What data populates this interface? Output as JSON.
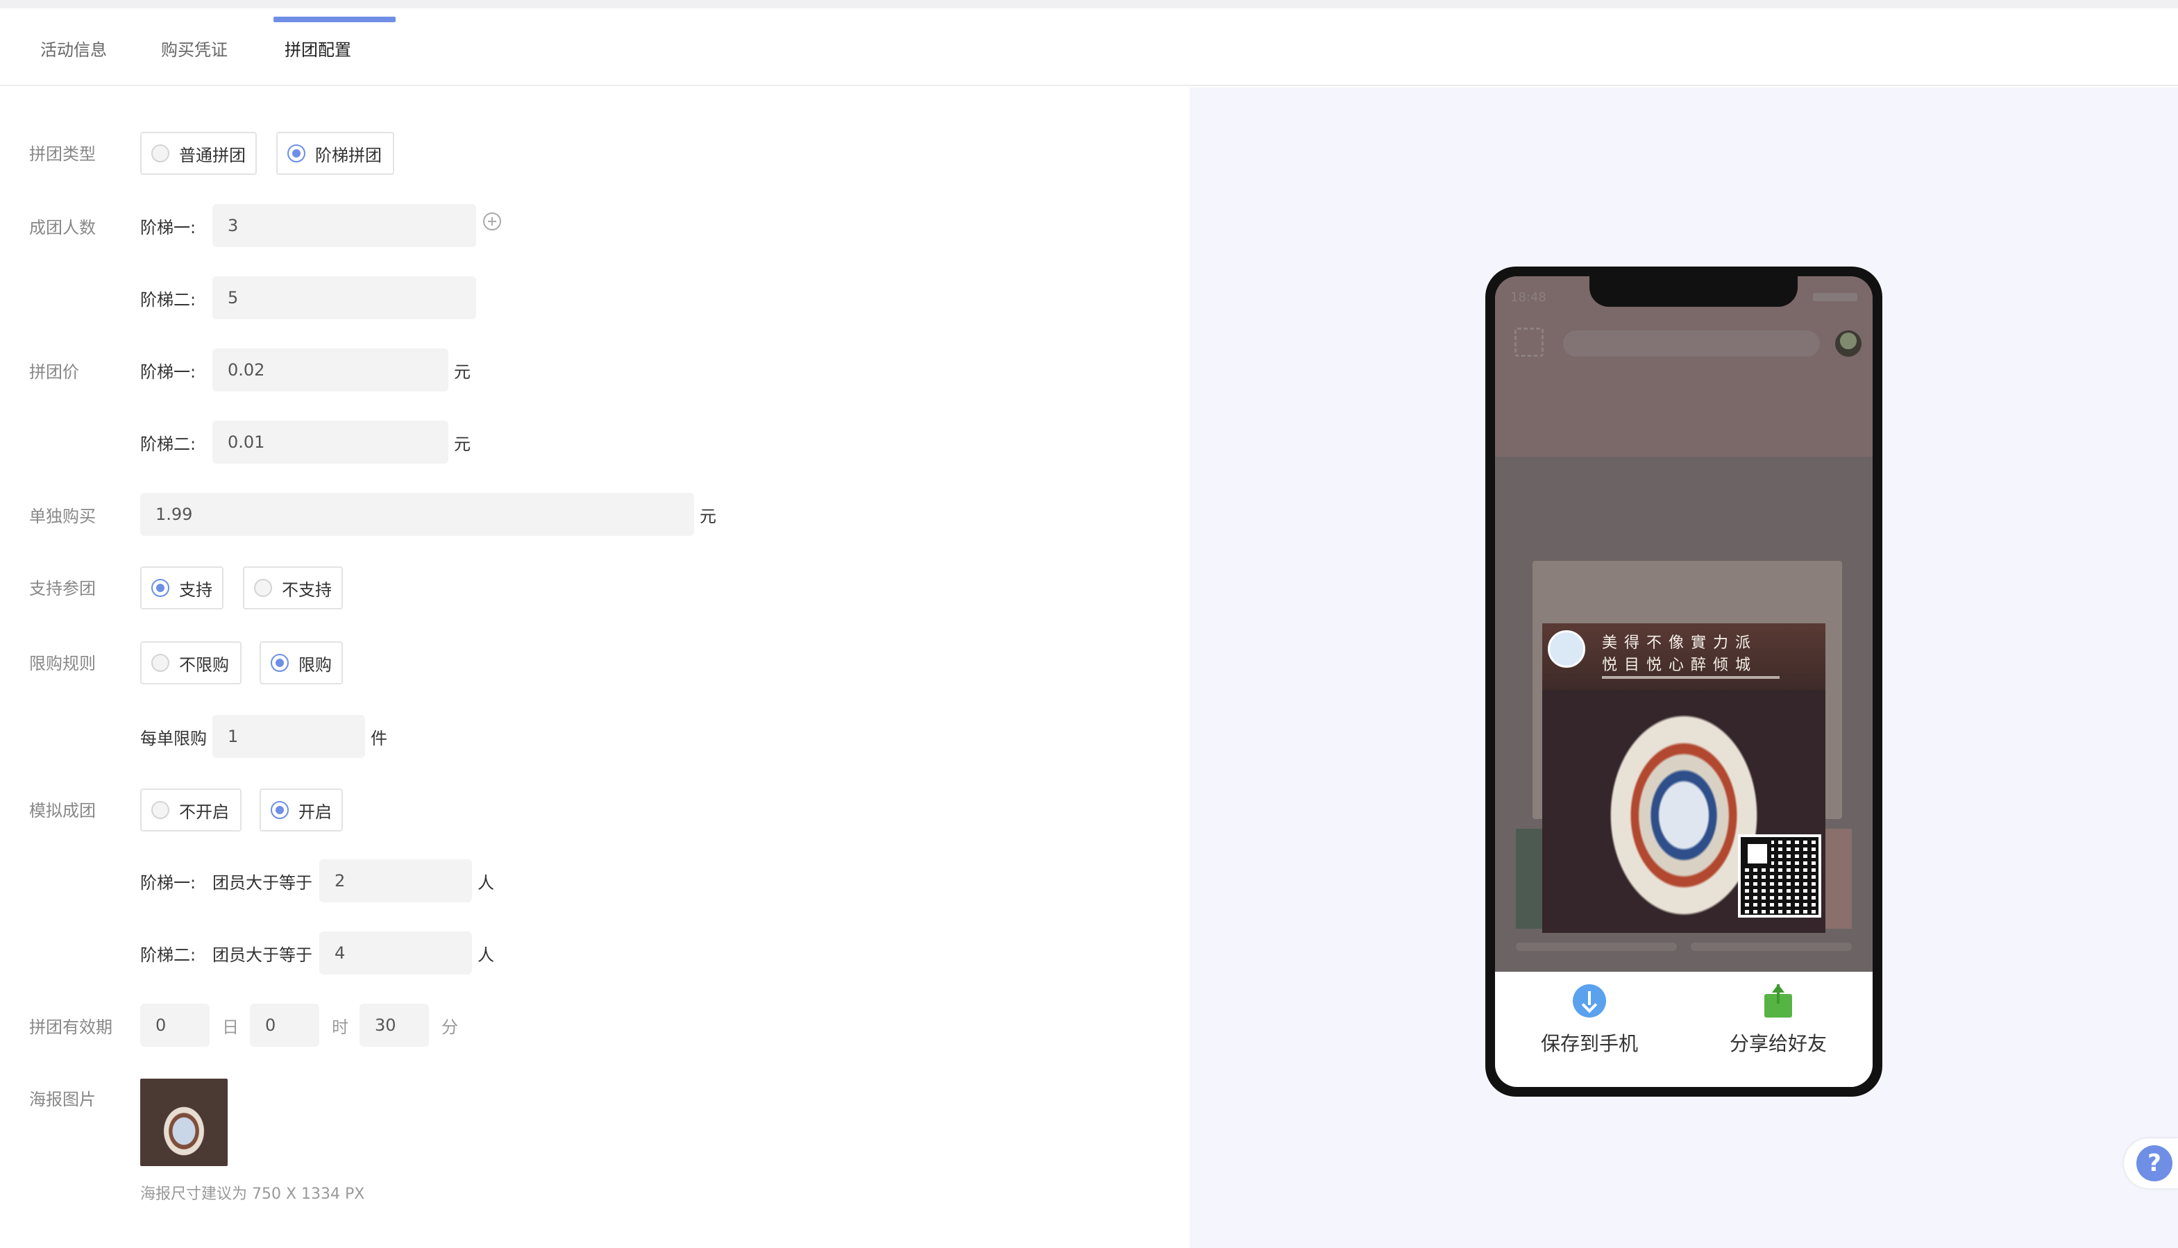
{
  "tabs": [
    {
      "label": "活动信息"
    },
    {
      "label": "购买凭证"
    },
    {
      "label": "拼团配置"
    }
  ],
  "active_tab": "拼团配置",
  "accent_color": "#6f8fe6",
  "form": {
    "group_type": {
      "label": "拼团类型",
      "options": [
        "普通拼团",
        "阶梯拼团"
      ],
      "selected": "阶梯拼团"
    },
    "group_size": {
      "label": "成团人数",
      "tier1_label": "阶梯一:",
      "tier1_value": "3",
      "tier2_label": "阶梯二:",
      "tier2_value": "5",
      "add_icon": "plus-circle-icon"
    },
    "group_price": {
      "label": "拼团价",
      "tier1_label": "阶梯一:",
      "tier1_value": "0.02",
      "tier2_label": "阶梯二:",
      "tier2_value": "0.01",
      "unit": "元"
    },
    "single_buy": {
      "label": "单独购买",
      "value": "1.99",
      "unit": "元"
    },
    "join_group": {
      "label": "支持参团",
      "options": [
        "支持",
        "不支持"
      ],
      "selected": "支持"
    },
    "purchase_limit": {
      "label": "限购规则",
      "options": [
        "不限购",
        "限购"
      ],
      "selected": "限购",
      "per_order_label": "每单限购",
      "per_order_value": "1",
      "unit": "件"
    },
    "simulated": {
      "label": "模拟成团",
      "options": [
        "不开启",
        "开启"
      ],
      "selected": "开启",
      "tier1_label": "阶梯一:",
      "tier2_label": "阶梯二:",
      "member_label": "团员大于等于",
      "tier1_value": "2",
      "tier2_value": "4",
      "unit": "人"
    },
    "validity": {
      "label": "拼团有效期",
      "days": "0",
      "day_unit": "日",
      "hours": "0",
      "hour_unit": "时",
      "minutes": "30",
      "minute_unit": "分"
    },
    "poster": {
      "label": "海报图片",
      "hint": "海报尺寸建议为 750 X 1334 PX"
    }
  },
  "preview": {
    "status_time": "18:48",
    "poster_line1": "美得不像實力派",
    "poster_line2": "悦目悦心醉倾城",
    "save_label": "保存到手机",
    "share_label": "分享给好友",
    "save_icon": "download-icon",
    "share_icon": "share-icon"
  },
  "help": {
    "symbol": "?"
  }
}
